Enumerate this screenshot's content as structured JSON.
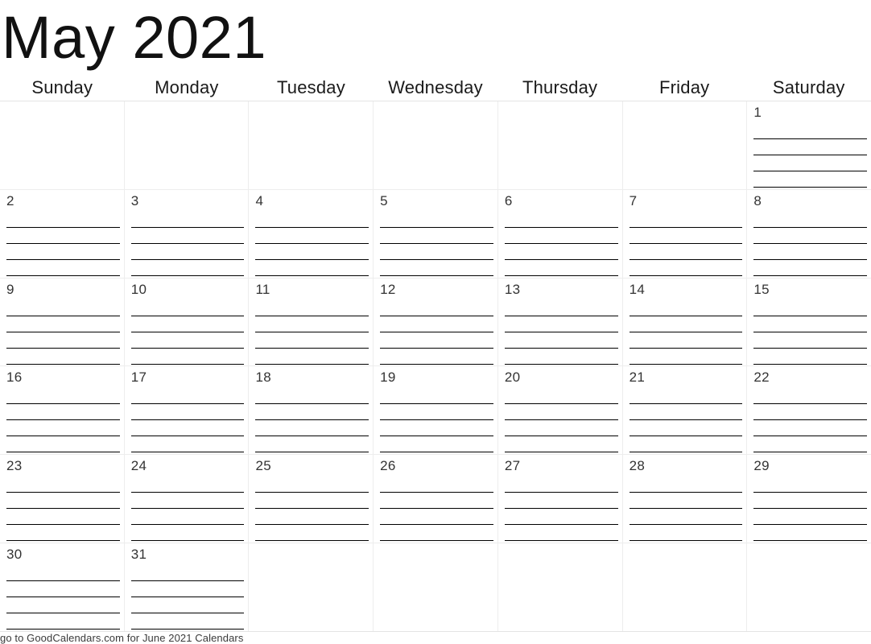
{
  "calendar": {
    "title": "May 2021",
    "month": "May",
    "year": "2021",
    "weekdays": [
      "Sunday",
      "Monday",
      "Tuesday",
      "Wednesday",
      "Thursday",
      "Friday",
      "Saturday"
    ],
    "lines_per_day": 4,
    "weeks": [
      [
        "",
        "",
        "",
        "",
        "",
        "",
        "1"
      ],
      [
        "2",
        "3",
        "4",
        "5",
        "6",
        "7",
        "8"
      ],
      [
        "9",
        "10",
        "11",
        "12",
        "13",
        "14",
        "15"
      ],
      [
        "16",
        "17",
        "18",
        "19",
        "20",
        "21",
        "22"
      ],
      [
        "23",
        "24",
        "25",
        "26",
        "27",
        "28",
        "29"
      ],
      [
        "30",
        "31",
        "",
        "",
        "",
        "",
        ""
      ]
    ],
    "colors": {
      "grid_line": "#ededed",
      "rule_line": "#000000",
      "text": "#1a1a1a",
      "background": "#ffffff"
    }
  },
  "footer": {
    "text": "go to GoodCalendars.com for June 2021 Calendars"
  }
}
